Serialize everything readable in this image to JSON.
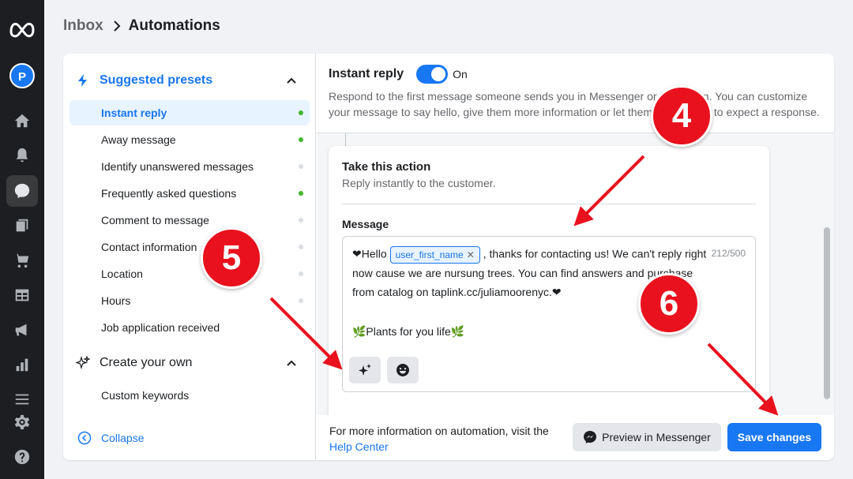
{
  "breadcrumb": {
    "parent": "Inbox",
    "current": "Automations"
  },
  "rail": {
    "avatar_letter": "P"
  },
  "sidebar": {
    "suggested_title": "Suggested presets",
    "items": [
      {
        "label": "Instant reply",
        "active": true,
        "status": "on"
      },
      {
        "label": "Away message",
        "status": "on"
      },
      {
        "label": "Identify unanswered messages",
        "status": "off"
      },
      {
        "label": "Frequently asked questions",
        "status": "on"
      },
      {
        "label": "Comment to message",
        "status": "off"
      },
      {
        "label": "Contact information",
        "status": "off"
      },
      {
        "label": "Location",
        "status": "off"
      },
      {
        "label": "Hours",
        "status": "off"
      },
      {
        "label": "Job application received",
        "status": "none"
      }
    ],
    "create_title": "Create your own",
    "create_items": [
      {
        "label": "Custom keywords"
      }
    ],
    "collapse_label": "Collapse"
  },
  "main": {
    "title": "Instant reply",
    "toggle_label": "On",
    "toggle_on": true,
    "description": "Respond to the first message someone sends you in Messenger or Instagram. You can customize your message to say hello, give them more information or let them know when to expect a response.",
    "action": {
      "title": "Take this action",
      "subtitle": "Reply instantly to the customer.",
      "message_label": "Message",
      "message": {
        "line1_prefix": "❤Hello",
        "chip": "user_first_name",
        "line1_suffix": ", thanks for contacting us! We can't reply right",
        "line2": "now cause we are nursung trees. You can find answers and purchase",
        "line3": "from catalog on taplink.cc/juliamoorenyc.❤",
        "line4": "🌿Plants for you life🌿"
      },
      "char_count": "212/500"
    },
    "footer": {
      "info_text": "For more information on automation, visit the",
      "help_link": "Help Center",
      "preview_button": "Preview in Messenger",
      "save_button": "Save changes"
    }
  },
  "annotations": {
    "badge_4": "4",
    "badge_5": "5",
    "badge_6": "6",
    "color": "#e8111d"
  },
  "colors": {
    "accent": "#1877f2",
    "rail": "#1c1e21",
    "active_dot": "#42b72a"
  }
}
